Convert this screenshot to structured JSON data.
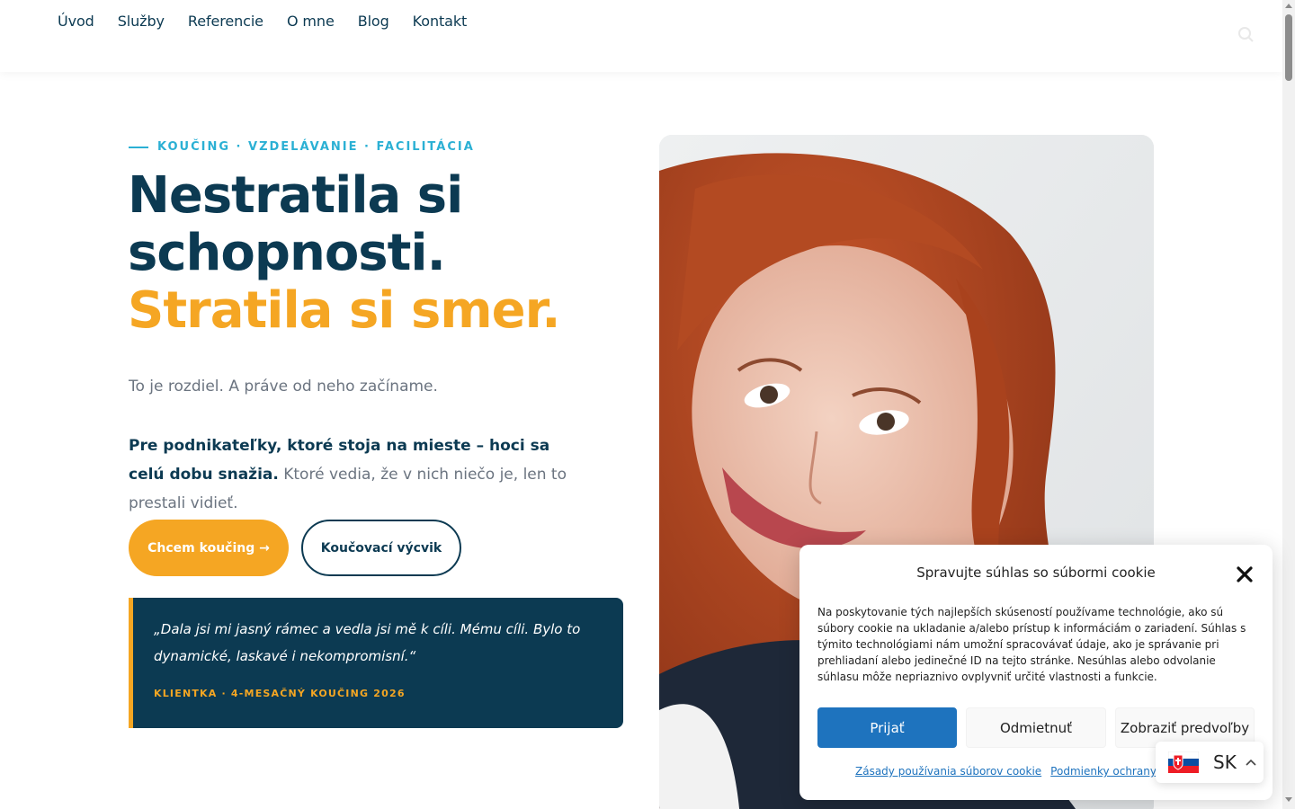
{
  "nav": {
    "items": [
      "Úvod",
      "Služby",
      "Referencie",
      "O mne",
      "Blog",
      "Kontakt"
    ]
  },
  "hero": {
    "eyebrow": "KOUČING · VZDELÁVANIE · FACILITÁCIA",
    "title_line1": "Nestratila si",
    "title_line2": "schopnosti.",
    "title_accent": "Stratila si smer.",
    "subtitle": "To je rozdiel. A práve od neho začíname.",
    "desc_bold": "Pre podnikateľky, ktoré stoja na mieste – hoci sa celú dobu snažia.",
    "desc_rest": " Ktoré vedia, že v nich niečo je, len to prestali vidieť.",
    "cta_primary": "Chcem koučing →",
    "cta_secondary": "Koučovací výcvik"
  },
  "testimonial": {
    "quote": "„Dala jsi mi jasný rámec a vedla jsi mě k cíli. Mému cíli. Bylo to dynamické, laskavé i nekompromisní.“",
    "meta": "KLIENTKA · 4-MESAČNÝ KOUČING 2026"
  },
  "cookie": {
    "title": "Spravujte súhlas so súbormi cookie",
    "body": "Na poskytovanie tých najlepších skúseností používame technológie, ako sú súbory cookie na ukladanie a/alebo prístup k informáciám o zariadení. Súhlas s týmito technológiami nám umožní spracovávať údaje, ako je správanie pri prehliadaní alebo jedinečné ID na tejto stránke. Nesúhlas alebo odvolanie súhlasu môže nepriaznivo ovplyvniť určité vlastnosti a funkcie.",
    "accept": "Prijať",
    "deny": "Odmietnuť",
    "prefs": "Zobraziť predvoľby",
    "link_cookies": "Zásady používania súborov cookie",
    "link_privacy": "Podmienky ochrany osobných údajov"
  },
  "lang": {
    "code": "SK"
  },
  "colors": {
    "navy": "#0c3a52",
    "accent": "#f5a623",
    "eyebrow": "#2bb0d4",
    "button_blue": "#1e73be"
  },
  "icons": {
    "search": "search-icon",
    "close": "close-icon",
    "flag": "slovak-flag-icon",
    "chevron": "chevron-up-icon"
  }
}
